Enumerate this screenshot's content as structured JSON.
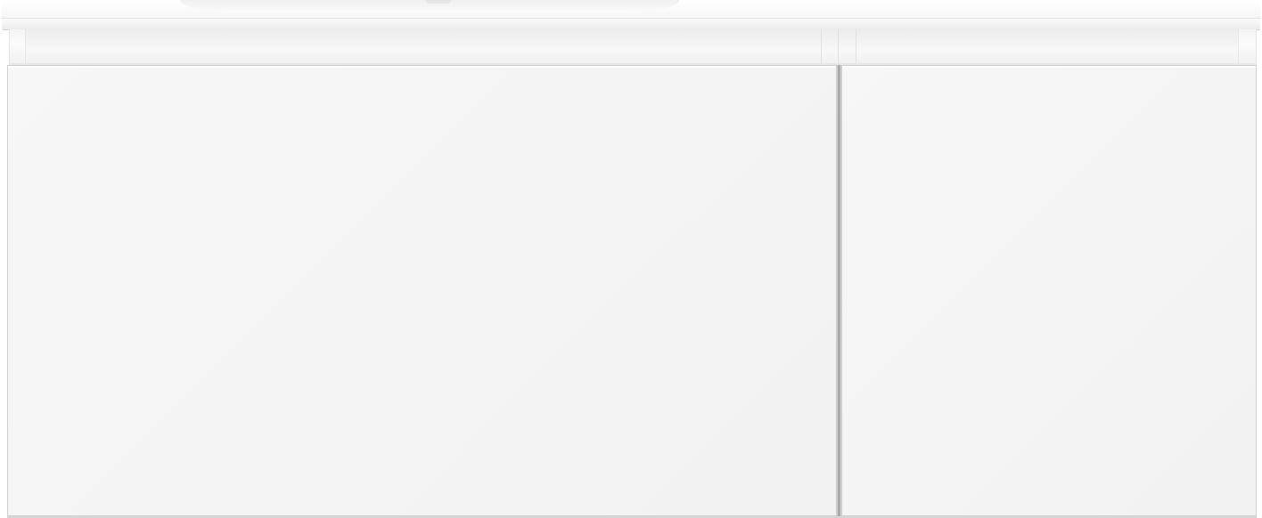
{
  "image": {
    "subject": "",
    "colors": {
      "cabinet": "#f4f4f4",
      "countertop": "#fafafa",
      "drawer_gap": "#9a9a9a",
      "background": "#ffffff"
    }
  },
  "vanity": {
    "drawers": [
      {
        "name": "left-drawer"
      },
      {
        "name": "right-drawer"
      }
    ]
  }
}
